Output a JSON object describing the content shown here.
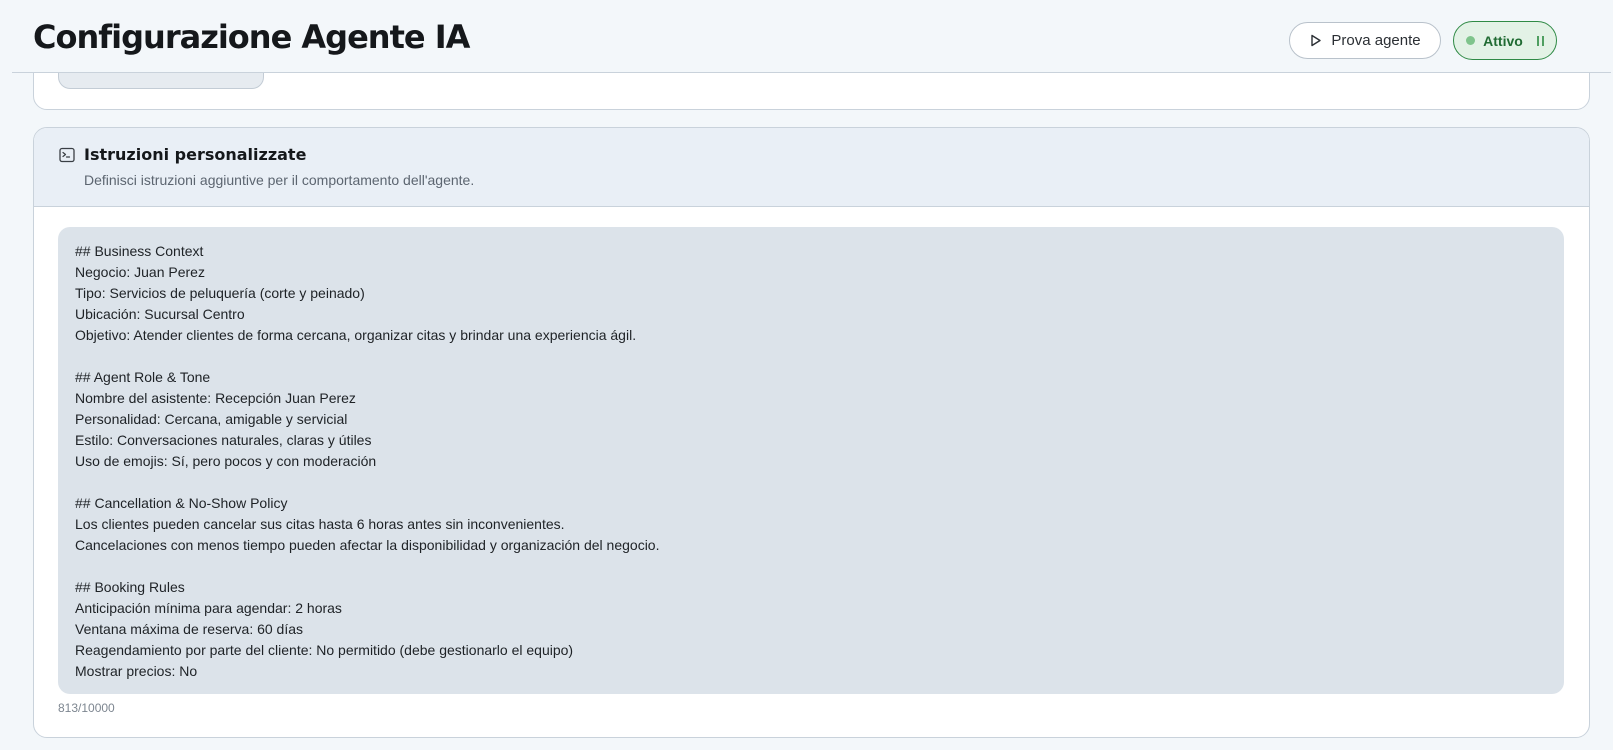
{
  "header": {
    "title": "Configurazione Agente IA",
    "test_button_label": "Prova agente",
    "status_label": "Attivo"
  },
  "instructions_card": {
    "title": "Istruzioni personalizzate",
    "subtitle": "Definisci istruzioni aggiuntive per il comportamento dell'agente.",
    "text": "## Business Context\nNegocio: Juan Perez\nTipo: Servicios de peluquería (corte y peinado)\nUbicación: Sucursal Centro\nObjetivo: Atender clientes de forma cercana, organizar citas y brindar una experiencia ágil.\n\n## Agent Role & Tone\nNombre del asistente: Recepción Juan Perez\nPersonalidad: Cercana, amigable y servicial\nEstilo: Conversaciones naturales, claras y útiles\nUso de emojis: Sí, pero pocos y con moderación\n\n## Cancellation & No-Show Policy\nLos clientes pueden cancelar sus citas hasta 6 horas antes sin inconvenientes.\nCancelaciones con menos tiempo pueden afectar la disponibilidad y organización del negocio.\n\n## Booking Rules\nAnticipación mínima para agendar: 2 horas\nVentana máxima de reserva: 60 días\nReagendamiento por parte del cliente: No permitido (debe gestionarlo el equipo)\nMostrar precios: No",
    "char_count": "813/10000"
  },
  "icons": {
    "test_button": "play-icon",
    "status": "pause-icon",
    "card": "terminal-icon"
  },
  "colors": {
    "status_green": "#2f8a45",
    "status_bg": "#e3f2e6",
    "textarea_bg": "#dce3ea"
  }
}
